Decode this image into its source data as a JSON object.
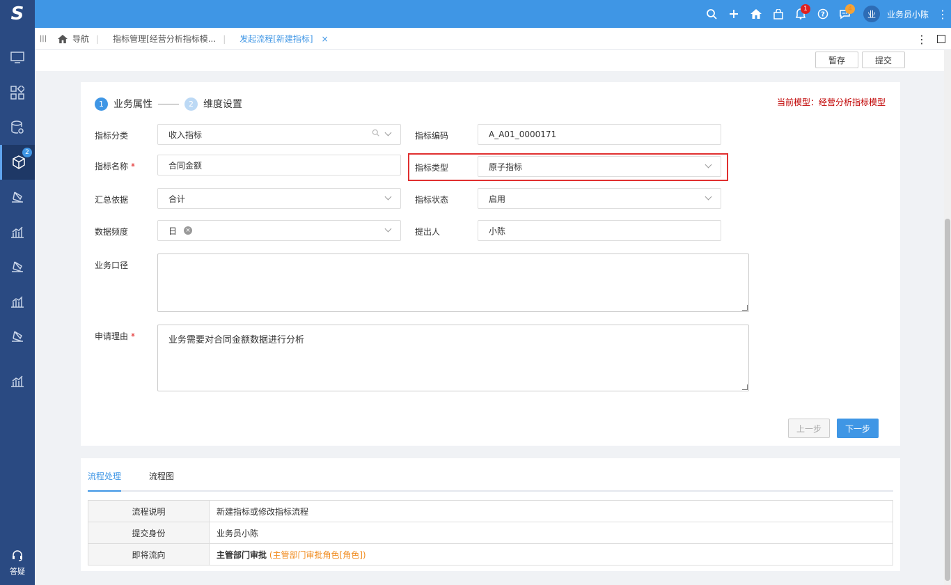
{
  "app": {
    "logo": "S"
  },
  "topbar": {
    "icons": [
      "search-icon",
      "plus-icon",
      "home-icon",
      "bag-icon",
      "bell-icon",
      "help-icon",
      "chat-icon"
    ],
    "bell_badge": "1",
    "chat_badge": "4",
    "avatar_text": "业",
    "user_name": "业务员小陈"
  },
  "sidebar": {
    "items": [
      "monitor-icon",
      "apps-icon",
      "database-gear-icon",
      "cube-icon",
      "layers-icon",
      "chart-icon",
      "layers-icon",
      "chart-icon",
      "layers-icon",
      "chart-icon"
    ],
    "active_badge": "2",
    "help_label": "答疑"
  },
  "tabs": [
    {
      "label": "导航"
    },
    {
      "label": "指标管理[经营分析指标模..."
    },
    {
      "label": "发起流程[新建指标]"
    }
  ],
  "actions": {
    "save_draft": "暂存",
    "submit": "提交"
  },
  "steps": [
    {
      "num": "1",
      "label": "业务属性"
    },
    {
      "num": "2",
      "label": "维度设置"
    }
  ],
  "model_hint": "当前模型：经营分析指标模型",
  "form": {
    "category_label": "指标分类",
    "category_value": "收入指标",
    "code_label": "指标编码",
    "code_value": "A_A01_0000171",
    "name_label": "指标名称",
    "name_value": "合同金额",
    "type_label": "指标类型",
    "type_value": "原子指标",
    "agg_label": "汇总依据",
    "agg_value": "合计",
    "status_label": "指标状态",
    "status_value": "启用",
    "freq_label": "数据频度",
    "freq_value": "日",
    "proposer_label": "提出人",
    "proposer_value": "小陈",
    "caliber_label": "业务口径",
    "caliber_value": "",
    "reason_label": "申请理由",
    "reason_value": "业务需要对合同金额数据进行分析",
    "required_mark": "*"
  },
  "nav_buttons": {
    "prev": "上一步",
    "next": "下一步"
  },
  "flow": {
    "tabs": [
      "流程处理",
      "流程图"
    ],
    "rows": [
      {
        "key": "流程说明",
        "value": "新建指标或修改指标流程"
      },
      {
        "key": "提交身份",
        "value": "业务员小陈"
      },
      {
        "key": "即将流向",
        "value": "主管部门审批",
        "extra": "(主管部门审批角色[角色])"
      }
    ]
  }
}
